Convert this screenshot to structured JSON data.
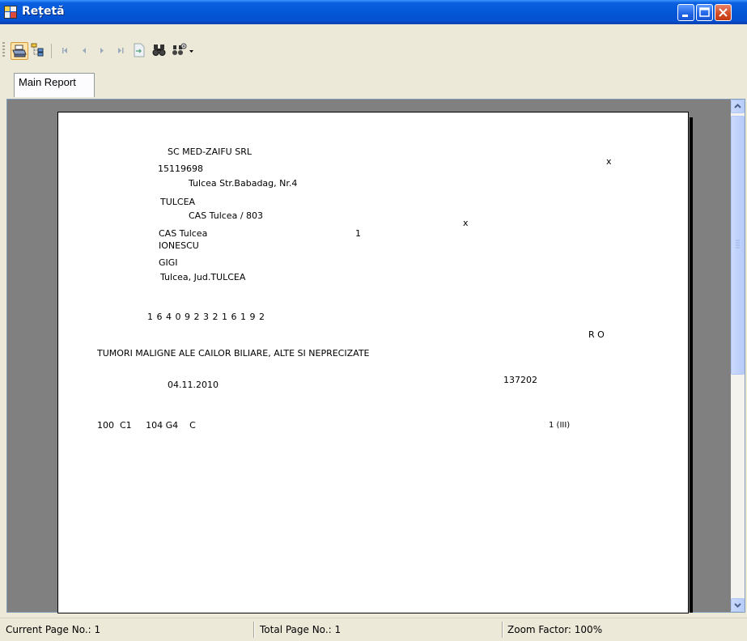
{
  "window": {
    "title": "Rețetă"
  },
  "toolbar": {
    "items": [
      "print-icon",
      "tree-icon",
      "first-page-icon",
      "prev-page-icon",
      "next-page-icon",
      "last-page-icon",
      "goto-page-icon",
      "find-icon",
      "zoom-icon"
    ]
  },
  "tabs": [
    {
      "label": "Main Report"
    }
  ],
  "report": {
    "company": "SC MED-ZAIFU SRL",
    "code": "15119698",
    "address": "Tulcea Str.Babadag, Nr.4",
    "city": "TULCEA",
    "cas": "CAS Tulcea / 803",
    "cas_short": "CAS Tulcea",
    "cas_num": "1",
    "mark_1": "x",
    "mark_2": "x",
    "surname": "IONESCU",
    "firstname": "GIGI",
    "residence": "Tulcea, Jud.TULCEA",
    "cnp": "1 6 4 0 9 2 3 2 1 6 1 9 2",
    "country": "R O",
    "diagnosis": "TUMORI MALIGNE ALE CAILOR BILIARE, ALTE SI NEPRECIZATE",
    "date": "04.11.2010",
    "number": "137202",
    "codes": "100  C1     104 G4    C",
    "qty": "1 (III)"
  },
  "status": {
    "current_page": "Current Page No.: 1",
    "total_page": "Total Page No.: 1",
    "zoom": "Zoom Factor: 100%"
  }
}
